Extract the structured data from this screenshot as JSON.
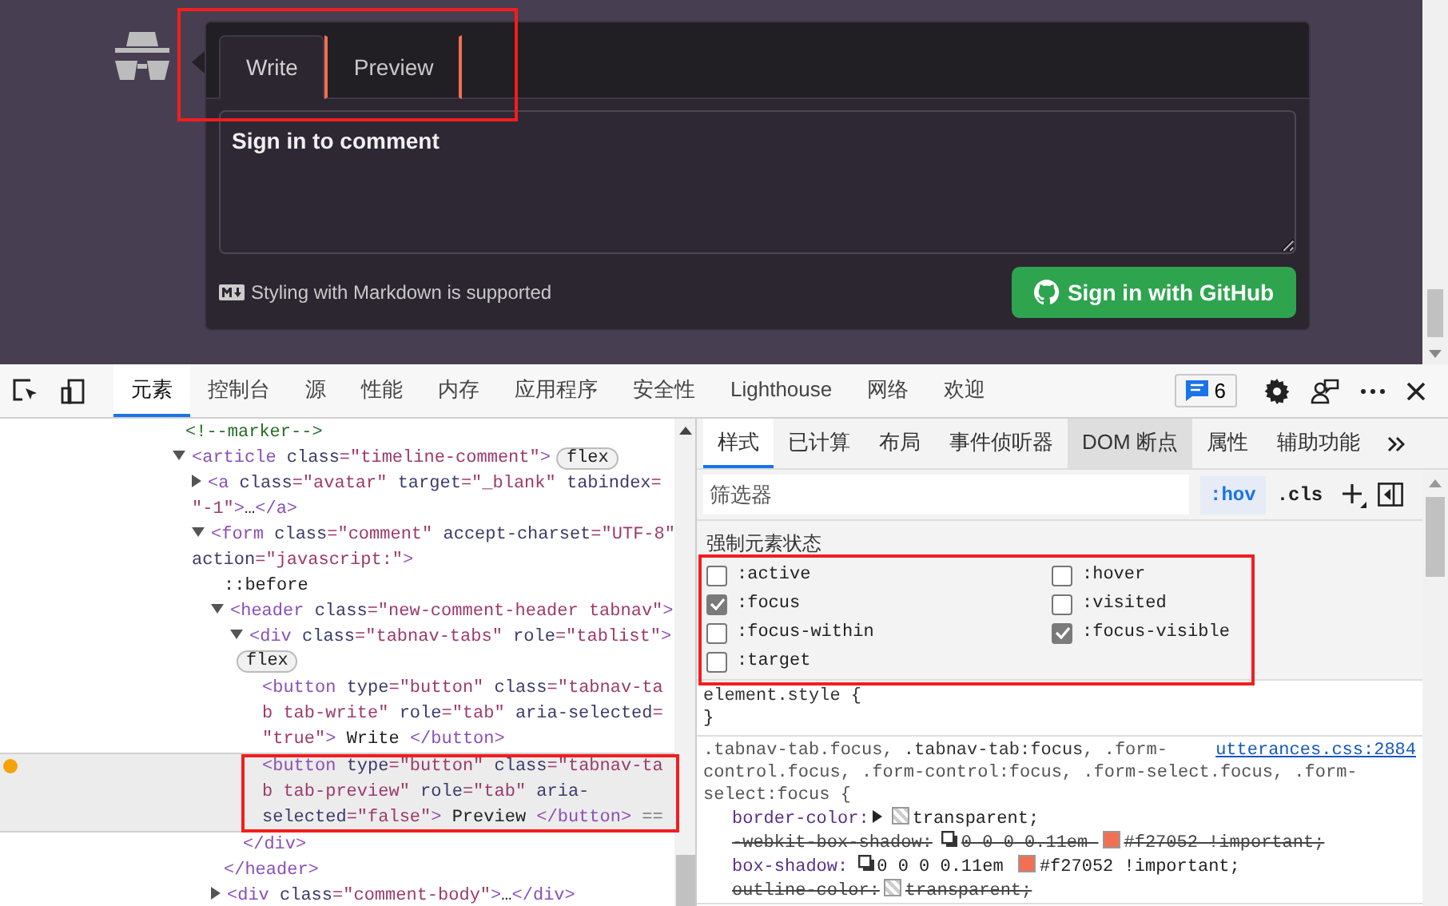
{
  "comment_form": {
    "tabs": [
      {
        "label": "Write",
        "selected": true,
        "focused": false
      },
      {
        "label": "Preview",
        "selected": false,
        "focused": true
      }
    ],
    "textarea": {
      "placeholder": "Sign in to comment"
    },
    "markdown_note": "Styling with Markdown is supported",
    "submit_button": "Sign in with GitHub"
  },
  "devtools": {
    "tabs": [
      {
        "label": "元素",
        "selected": true
      },
      {
        "label": "控制台",
        "selected": false
      },
      {
        "label": "源",
        "selected": false
      },
      {
        "label": "性能",
        "selected": false
      },
      {
        "label": "内存",
        "selected": false
      },
      {
        "label": "应用程序",
        "selected": false
      },
      {
        "label": "安全性",
        "selected": false
      },
      {
        "label": "Lighthouse",
        "selected": false
      },
      {
        "label": "网络",
        "selected": false
      },
      {
        "label": "欢迎",
        "selected": false
      }
    ],
    "issues_count": "6",
    "dom_tree": [
      {
        "selected": false,
        "lines": [
          [
            {
              "kind": "comment",
              "text": "<!--marker-->"
            }
          ]
        ]
      },
      {
        "selected": false,
        "expanded": true,
        "lines": [
          [
            {
              "kind": "tag",
              "text": "<article"
            },
            {
              "kind": "attr",
              "text": " class"
            },
            {
              "kind": "value",
              "text": "=\"timeline-comment\""
            },
            {
              "kind": "tag",
              "text": ">"
            },
            {
              "kind": "badge",
              "text": "flex"
            }
          ]
        ],
        "children": [
          {
            "selected": false,
            "expanded": false,
            "lines": [
              [
                {
                  "kind": "tag",
                  "text": "<a"
                },
                {
                  "kind": "attr",
                  "text": " class"
                },
                {
                  "kind": "value",
                  "text": "=\"avatar\""
                },
                {
                  "kind": "attr",
                  "text": " target"
                },
                {
                  "kind": "value",
                  "text": "=\"_blank\""
                },
                {
                  "kind": "attr",
                  "text": " tabindex"
                },
                {
                  "kind": "value",
                  "text": "="
                }
              ],
              [
                {
                  "kind": "value",
                  "text": "\"-1\""
                },
                {
                  "kind": "tag",
                  "text": ">"
                },
                {
                  "kind": "plain",
                  "text": "…"
                },
                {
                  "kind": "tag",
                  "text": "</a>"
                }
              ]
            ]
          },
          {
            "selected": false,
            "expanded": true,
            "lines": [
              [
                {
                  "kind": "tag",
                  "text": "<form"
                },
                {
                  "kind": "attr",
                  "text": " class"
                },
                {
                  "kind": "value",
                  "text": "=\"comment\""
                },
                {
                  "kind": "attr",
                  "text": " accept-charset"
                },
                {
                  "kind": "value",
                  "text": "=\"UTF-8\""
                }
              ],
              [
                {
                  "kind": "attr",
                  "text": "action"
                },
                {
                  "kind": "value",
                  "text": "=\"javascript:\""
                },
                {
                  "kind": "tag",
                  "text": ">"
                }
              ]
            ],
            "children": [
              {
                "selected": false,
                "lines": [
                  [
                    {
                      "kind": "plain",
                      "text": "::before"
                    }
                  ]
                ]
              },
              {
                "selected": false,
                "expanded": true,
                "lines": [
                  [
                    {
                      "kind": "tag",
                      "text": "<header"
                    },
                    {
                      "kind": "attr",
                      "text": " class"
                    },
                    {
                      "kind": "value",
                      "text": "=\"new-comment-header tabnav\""
                    },
                    {
                      "kind": "tag",
                      "text": ">"
                    }
                  ]
                ],
                "close": [
                  [
                    {
                      "kind": "tag",
                      "text": "</header>"
                    }
                  ]
                ],
                "children": [
                  {
                    "selected": false,
                    "expanded": true,
                    "lines": [
                      [
                        {
                          "kind": "tag",
                          "text": "<div"
                        },
                        {
                          "kind": "attr",
                          "text": " class"
                        },
                        {
                          "kind": "value",
                          "text": "=\"tabnav-tabs\""
                        },
                        {
                          "kind": "attr",
                          "text": " role"
                        },
                        {
                          "kind": "value",
                          "text": "=\"tablist\""
                        },
                        {
                          "kind": "tag",
                          "text": ">"
                        }
                      ],
                      [
                        {
                          "kind": "badge",
                          "text": "flex"
                        }
                      ]
                    ],
                    "close": [
                      [
                        {
                          "kind": "tag",
                          "text": "</div>"
                        }
                      ]
                    ],
                    "children": [
                      {
                        "selected": false,
                        "lines": [
                          [
                            {
                              "kind": "tag",
                              "text": "<button"
                            },
                            {
                              "kind": "attr",
                              "text": " type"
                            },
                            {
                              "kind": "value",
                              "text": "=\"button\""
                            },
                            {
                              "kind": "attr",
                              "text": " class"
                            },
                            {
                              "kind": "value",
                              "text": "=\"tabnav-ta"
                            }
                          ],
                          [
                            {
                              "kind": "value",
                              "text": "b tab-write\""
                            },
                            {
                              "kind": "attr",
                              "text": " role"
                            },
                            {
                              "kind": "value",
                              "text": "=\"tab\""
                            },
                            {
                              "kind": "attr",
                              "text": " aria-selected"
                            },
                            {
                              "kind": "value",
                              "text": "="
                            }
                          ],
                          [
                            {
                              "kind": "value",
                              "text": "\"true\""
                            },
                            {
                              "kind": "tag",
                              "text": ">"
                            },
                            {
                              "kind": "plain",
                              "text": " Write "
                            },
                            {
                              "kind": "tag",
                              "text": "</button>"
                            }
                          ]
                        ]
                      },
                      {
                        "selected": true,
                        "flagged": true,
                        "lines": [
                          [
                            {
                              "kind": "tag",
                              "text": "<button"
                            },
                            {
                              "kind": "attr",
                              "text": " type"
                            },
                            {
                              "kind": "value",
                              "text": "=\"button\""
                            },
                            {
                              "kind": "attr",
                              "text": " class"
                            },
                            {
                              "kind": "value",
                              "text": "=\"tabnav-ta"
                            }
                          ],
                          [
                            {
                              "kind": "value",
                              "text": "b tab-preview\""
                            },
                            {
                              "kind": "attr",
                              "text": " role"
                            },
                            {
                              "kind": "value",
                              "text": "=\"tab\""
                            },
                            {
                              "kind": "attr",
                              "text": " aria-"
                            }
                          ],
                          [
                            {
                              "kind": "attr",
                              "text": "selected"
                            },
                            {
                              "kind": "value",
                              "text": "=\"false\""
                            },
                            {
                              "kind": "tag",
                              "text": ">"
                            },
                            {
                              "kind": "plain",
                              "text": " Preview "
                            },
                            {
                              "kind": "tag",
                              "text": "</button>"
                            },
                            {
                              "kind": "muted",
                              "text": " =="
                            }
                          ]
                        ]
                      }
                    ]
                  }
                ]
              },
              {
                "selected": false,
                "expanded": false,
                "lines": [
                  [
                    {
                      "kind": "tag",
                      "text": "<div"
                    },
                    {
                      "kind": "attr",
                      "text": " class"
                    },
                    {
                      "kind": "value",
                      "text": "=\"comment-body\""
                    },
                    {
                      "kind": "tag",
                      "text": ">"
                    },
                    {
                      "kind": "plain",
                      "text": "…"
                    },
                    {
                      "kind": "tag",
                      "text": "</div>"
                    }
                  ]
                ]
              }
            ]
          }
        ]
      }
    ],
    "styles_panel": {
      "tabs": [
        {
          "label": "样式",
          "selected": true,
          "hovered": false
        },
        {
          "label": "已计算",
          "selected": false,
          "hovered": false
        },
        {
          "label": "布局",
          "selected": false,
          "hovered": false
        },
        {
          "label": "事件侦听器",
          "selected": false,
          "hovered": false
        },
        {
          "label": "DOM 断点",
          "selected": false,
          "hovered": true
        },
        {
          "label": "属性",
          "selected": false,
          "hovered": false
        },
        {
          "label": "辅助功能",
          "selected": false,
          "hovered": false
        }
      ],
      "filter": {
        "placeholder": "筛选器"
      },
      "hov_button": {
        "label": ":hov",
        "active": true
      },
      "cls_button": ".cls",
      "force_state": {
        "title": "强制元素状态",
        "states": [
          {
            "label": ":active",
            "checked": false
          },
          {
            "label": ":hover",
            "checked": false
          },
          {
            "label": ":focus",
            "checked": true
          },
          {
            "label": ":visited",
            "checked": false
          },
          {
            "label": ":focus-within",
            "checked": false
          },
          {
            "label": ":focus-visible",
            "checked": true
          },
          {
            "label": ":target",
            "checked": false
          }
        ]
      },
      "rules": [
        {
          "selector_lines": [
            [
              {
                "text": "element.style {",
                "matched": true
              }
            ]
          ],
          "close": "}"
        },
        {
          "selector_lines": [
            [
              {
                "text": ".tabnav-tab.focus, ",
                "matched": false
              },
              {
                "text": ".tabnav-tab:focus",
                "matched": true
              },
              {
                "text": ", .form-",
                "matched": false
              }
            ],
            [
              {
                "text": "control.focus, .form-control:focus, .form-select.focus, .form-",
                "matched": false
              }
            ],
            [
              {
                "text": "select:focus {",
                "matched": false
              }
            ]
          ],
          "source": "utterances.css:2884",
          "properties": [
            {
              "name": "border-color:",
              "struck": false,
              "parts": [
                {
                  "kind": "arrow"
                },
                {
                  "kind": "transparent_swatch"
                },
                {
                  "kind": "text",
                  "text": "transparent;"
                }
              ]
            },
            {
              "name": "-webkit-box-shadow:",
              "struck": true,
              "parts": [
                {
                  "kind": "shadow"
                },
                {
                  "kind": "text",
                  "text": "0 0 0 0.11em "
                },
                {
                  "kind": "swatch",
                  "color": "#f27052"
                },
                {
                  "kind": "text",
                  "text": "#f27052 !important;"
                }
              ]
            },
            {
              "name": "box-shadow:",
              "struck": false,
              "parts": [
                {
                  "kind": "shadow"
                },
                {
                  "kind": "text",
                  "text": "0 0 0 0.11em "
                },
                {
                  "kind": "swatch",
                  "color": "#f27052"
                },
                {
                  "kind": "text",
                  "text": "#f27052 !important;"
                }
              ]
            },
            {
              "name": "outline-color:",
              "struck": true,
              "parts": [
                {
                  "kind": "transparent_swatch"
                },
                {
                  "kind": "text",
                  "text": "transparent;"
                }
              ]
            }
          ]
        }
      ]
    }
  }
}
